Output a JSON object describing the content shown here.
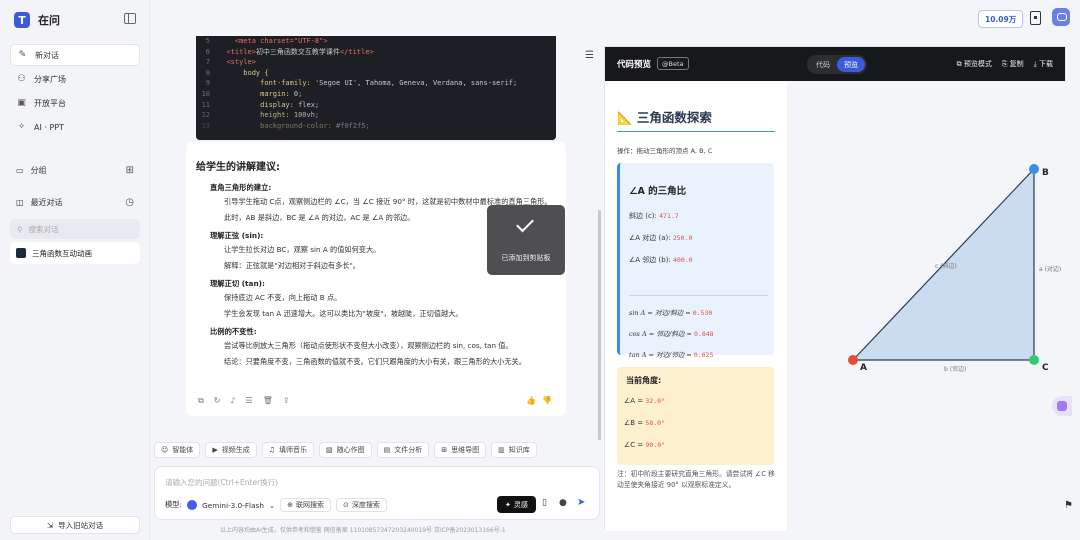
{
  "sidebar": {
    "app_name": "在问",
    "nav": [
      {
        "label": "新对话",
        "icon": "new-chat-icon",
        "glyph": "✎"
      },
      {
        "label": "分享广场",
        "icon": "share-icon",
        "glyph": "⚇"
      },
      {
        "label": "开放平台",
        "icon": "platform-icon",
        "glyph": "▣"
      },
      {
        "label": "AI · PPT",
        "icon": "ppt-icon",
        "glyph": "✧"
      }
    ],
    "group_label": "分组",
    "recent_label": "最近对话",
    "search_placeholder": "搜索对话",
    "history": [
      "三角函数互动动画"
    ],
    "import_label": "导入旧站对话"
  },
  "code": [
    {
      "n": "5",
      "parts": [
        {
          "t": "    <meta charset=\"UTF-8\">",
          "c": "tag"
        }
      ]
    },
    {
      "n": "6",
      "parts": [
        {
          "t": "  <title>",
          "c": "tag"
        },
        {
          "t": "初中三角函数交互教学课件",
          "c": "val"
        },
        {
          "t": "</title>",
          "c": "tag"
        }
      ]
    },
    {
      "n": "7",
      "parts": [
        {
          "t": "  <style>",
          "c": "tag"
        }
      ]
    },
    {
      "n": "8",
      "parts": [
        {
          "t": "      body {",
          "c": "prop"
        }
      ]
    },
    {
      "n": "9",
      "parts": [
        {
          "t": "          font-family: ",
          "c": "prop"
        },
        {
          "t": "'Segoe UI', Tahoma, Geneva, Verdana, sans-serif;",
          "c": "val"
        }
      ]
    },
    {
      "n": "10",
      "parts": [
        {
          "t": "          margin: ",
          "c": "prop"
        },
        {
          "t": "0;",
          "c": "val"
        }
      ]
    },
    {
      "n": "11",
      "parts": [
        {
          "t": "          display: ",
          "c": "prop"
        },
        {
          "t": "flex;",
          "c": "val"
        }
      ]
    },
    {
      "n": "12",
      "parts": [
        {
          "t": "          height: ",
          "c": "prop"
        },
        {
          "t": "100vh;",
          "c": "val"
        }
      ]
    },
    {
      "n": "13",
      "parts": [
        {
          "t": "          background-color: ",
          "c": "prop"
        },
        {
          "t": "#f0f2f5;",
          "c": "val"
        }
      ]
    }
  ],
  "answer": {
    "heading": "给学生的讲解建议:",
    "items": [
      {
        "title": "直角三角形的建立:",
        "paras": [
          "引导学生拖动 C点，观察侧边栏的 ∠C，当 ∠C 接近 90° 时，这就是初中数材中最标准的直角三角形。",
          "此时，AB 是斜边，BC 是 ∠A 的对边，AC 是 ∠A 的邻边。"
        ]
      },
      {
        "title": "理解正弦 (sin):",
        "paras": [
          "让学生拉长对边 BC，观察 sin A 的值如何变大。",
          "解释：正弦就是\"对边相对于斜边有多长\"。"
        ]
      },
      {
        "title": "理解正切 (tan):",
        "paras": [
          "保持底边 AC 不变，向上拖动 B 点。",
          "学生会发现 tan A 迅速增大。这可以类比为\"坡度\"，坡越陡，正切值越大。"
        ]
      },
      {
        "title": "比例的不变性:",
        "paras": [
          "尝试等比例放大三角形（拖动点使形状不变但大小改变），观察侧边栏的 sin, cos, tan 值。",
          "结论：只要角度不变，三角函数的值就不变。它们只跟角度的大小有关，跟三角形的大小无关。"
        ]
      }
    ]
  },
  "toast": "已添加到剪贴板",
  "tools": [
    {
      "label": "智能体",
      "glyph": "☺"
    },
    {
      "label": "视频生成",
      "glyph": "▶"
    },
    {
      "label": "填师音乐",
      "glyph": "♫"
    },
    {
      "label": "随心作图",
      "glyph": "▨"
    },
    {
      "label": "文件分析",
      "glyph": "▤"
    },
    {
      "label": "思维导图",
      "glyph": "⊞"
    },
    {
      "label": "知识库",
      "glyph": "▥"
    }
  ],
  "input": {
    "placeholder": "请输入您的问题(Ctrl+Enter换行)",
    "model_label": "模型:",
    "model": "Gemini-3.0-Flash",
    "search_label": "联网搜索",
    "deep_label": "深度搜索",
    "inspire_label": "灵感"
  },
  "footer": "以上内容均由AI生成，仅供参考和借鉴 网信备案 11010857347203240019号 京ICP备2023013166号-1",
  "preview": {
    "title": "代码预览",
    "badge": "@Beta",
    "tabs": [
      "代码",
      "预览"
    ],
    "active_tab": "预览",
    "actions": [
      "预览模式",
      "复制",
      "下载"
    ],
    "page_title": "三角函数探索",
    "operation": "操作：拖动三角形的顶点 A, B, C",
    "card_title": "∠A 的三角比",
    "rows": [
      {
        "label": "斜边 (c):",
        "value": "471.7"
      },
      {
        "label": "∠A 对边 (a):",
        "value": "250.0"
      },
      {
        "label": "∠A 邻边 (b):",
        "value": "400.0"
      }
    ],
    "trig": [
      {
        "label": "sin A = 对边/斜边 =",
        "value": "0.530"
      },
      {
        "label": "cos A = 邻边/斜边 =",
        "value": "0.848"
      },
      {
        "label": "tan A = 对边/邻边 =",
        "value": "0.625"
      }
    ],
    "angles_title": "当前角度:",
    "angles": [
      {
        "label": "∠A =",
        "value": "32.0°"
      },
      {
        "label": "∠B =",
        "value": "58.0°"
      },
      {
        "label": "∠C =",
        "value": "90.0°"
      }
    ],
    "note": "注：初中阶段主要研究直角三角形。请尝试将 ∠C 移动至使夹角接近 90° 以观察标准定义。",
    "triangle": {
      "labels": {
        "A": "A",
        "B": "B",
        "C": "C"
      },
      "side_c": "c (斜边)",
      "side_a": "a (对边)",
      "side_b": "b (邻边)",
      "colors": {
        "A": "#e74c3c",
        "B": "#3a8ee6",
        "C": "#2ecc71",
        "fill": "#c9dcf0",
        "stroke": "#2b3a52"
      }
    }
  },
  "credit": "10.09万"
}
